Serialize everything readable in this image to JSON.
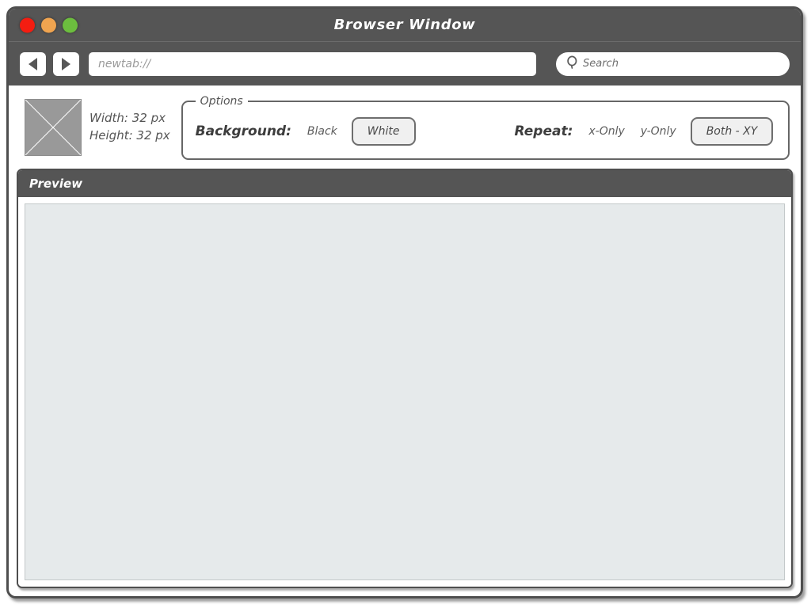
{
  "window": {
    "title": "Browser Window",
    "traffic_lights": [
      {
        "name": "close",
        "color": "#f41d11"
      },
      {
        "name": "minimize",
        "color": "#f0a450"
      },
      {
        "name": "maximize",
        "color": "#6cbd3e"
      }
    ]
  },
  "toolbar": {
    "back_icon": "triangle-left-icon",
    "forward_icon": "triangle-right-icon",
    "url_value": "newtab://",
    "search_placeholder": "Search",
    "search_icon": "magnifier-icon"
  },
  "options": {
    "legend": "Options",
    "image": {
      "icon": "broken-image-placeholder",
      "width_label": "Width: 32 px",
      "height_label": "Height: 32 px"
    },
    "background": {
      "label": "Background:",
      "choices": [
        "Black",
        "White"
      ],
      "selected": "White"
    },
    "repeat": {
      "label": "Repeat:",
      "choices": [
        "x-Only",
        "y-Only",
        "Both - XY"
      ],
      "selected": "Both - XY"
    }
  },
  "preview": {
    "header": "Preview",
    "canvas_color": "#e6eaeb"
  }
}
